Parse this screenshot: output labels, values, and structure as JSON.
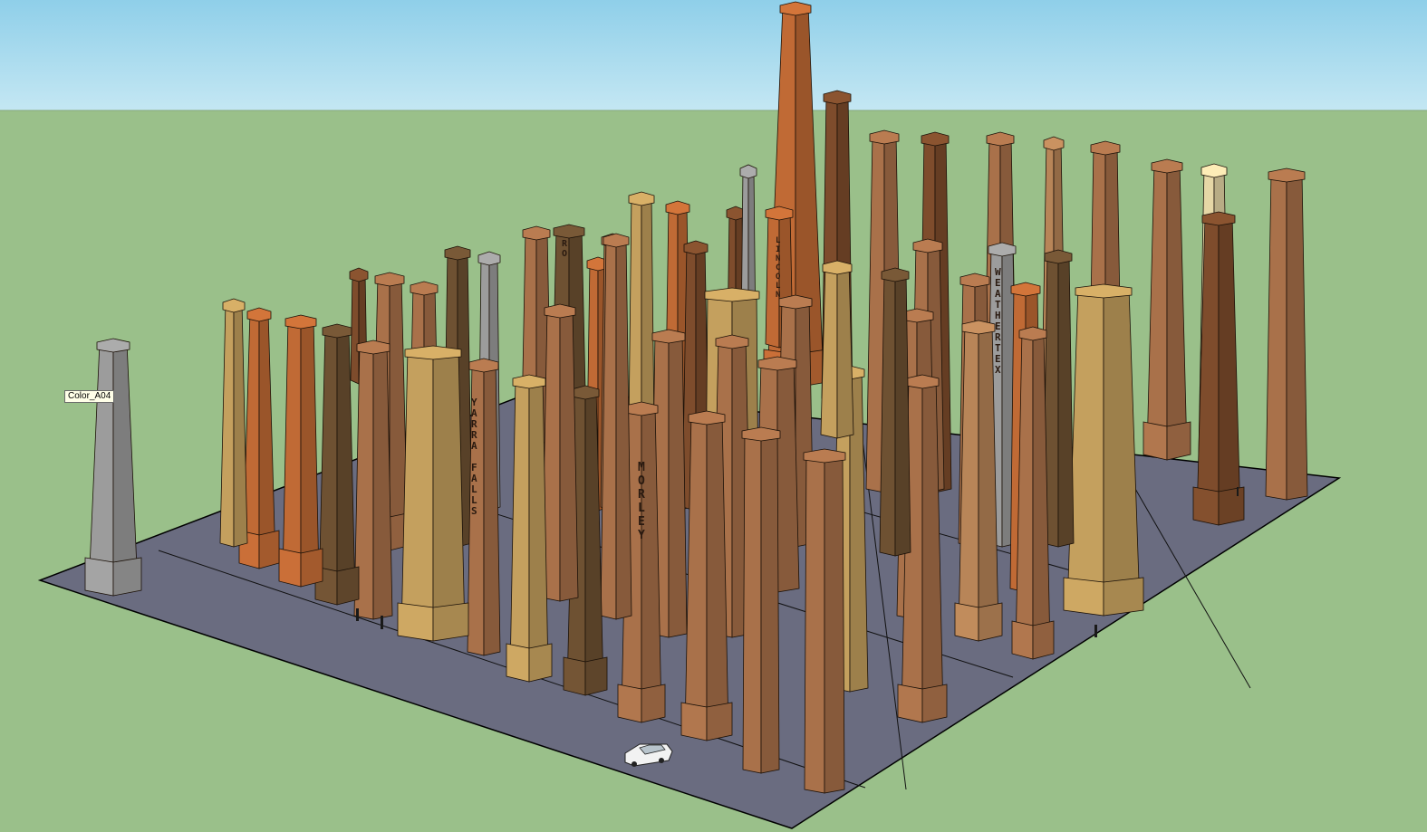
{
  "viewport": {
    "sky_color": "#a7dbef",
    "ground_color": "#9ac08a",
    "plaza_color": "#6a6c80",
    "hover_label": "Color_A04"
  },
  "signs": {
    "morley": "MORLEY",
    "yarra_falls": "YARRA FALLS",
    "weathertex": "WEATHERTEX",
    "lincoln": "LINCOLN",
    "ro": "RO"
  },
  "palette": {
    "brick": "#a9714a",
    "brick_light": "#b88558",
    "brick_dark": "#7e4c2c",
    "tan": "#c4a05e",
    "orange": "#c06a35",
    "grey": "#9c9c9c",
    "cream": "#e6d7a6",
    "dark_brown": "#6e5132"
  },
  "selected_object": "Color_A04"
}
